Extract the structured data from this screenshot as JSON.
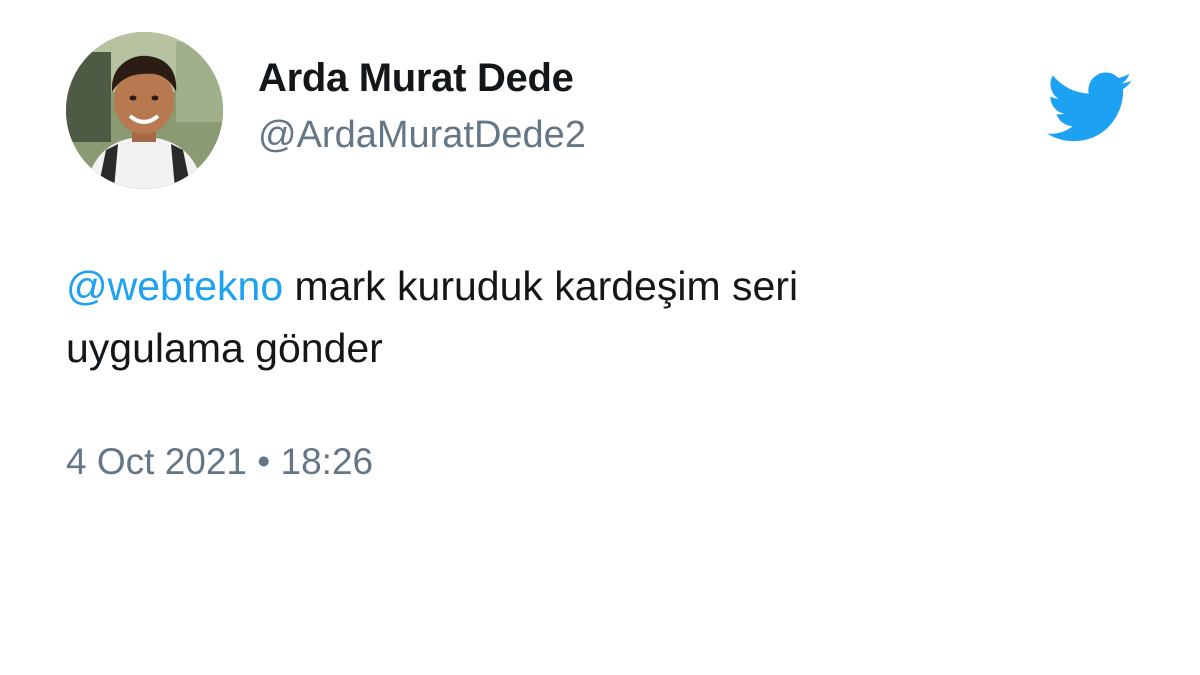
{
  "author": {
    "display_name": "Arda Murat Dede",
    "handle": "@ArdaMuratDede2"
  },
  "tweet": {
    "mention": "@webtekno",
    "text_line1": " mark kuruduk kardeşim seri",
    "text_line2": "uygulama gönder"
  },
  "meta": {
    "date": "4 Oct 2021",
    "separator": " • ",
    "time": "18:26"
  },
  "icons": {
    "brand": "twitter-bird-icon"
  },
  "colors": {
    "brand": "#1da1f2",
    "text": "#14171a",
    "secondary": "#657786",
    "background": "#ffffff"
  }
}
